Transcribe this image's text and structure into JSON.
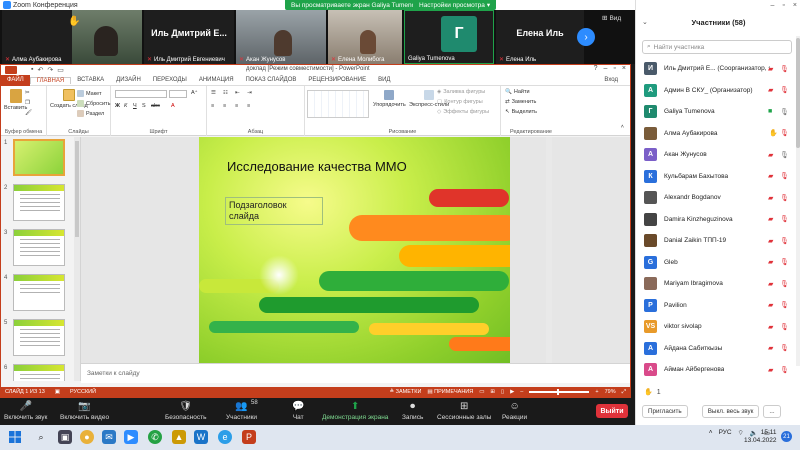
{
  "zoom": {
    "app_title": "Zoom Конференция",
    "share_banner": "Вы просматриваете экран Galiya Tumenova",
    "view_settings": "Настройки просмотра",
    "view_label": "Вид",
    "tiles": [
      {
        "name": "Алма Аубакирова",
        "type": "video",
        "raise_hand": true
      },
      {
        "name": "Иль Дмитрий Евгениевич",
        "big": "Иль Дмитрий Е...",
        "type": "name"
      },
      {
        "name": "Акан Жунусов",
        "type": "video"
      },
      {
        "name": "Елена Молибога",
        "type": "video"
      },
      {
        "name": "Galiya Tumenova",
        "letter": "Г",
        "type": "letter"
      },
      {
        "name": "Елена Иль",
        "big": "Елена Иль",
        "type": "name"
      }
    ],
    "controls": [
      {
        "label": "Включить звук",
        "icon": "🎤"
      },
      {
        "label": "Включить видео",
        "icon": "📷"
      },
      {
        "label": "Безопасность",
        "icon": "🛡"
      },
      {
        "label": "Участники",
        "icon": "👥",
        "count": "58"
      },
      {
        "label": "Чат",
        "icon": "💬"
      },
      {
        "label": "Демонстрация экрана",
        "icon": "⬆"
      },
      {
        "label": "Запись",
        "icon": "⏺"
      },
      {
        "label": "Сессионные залы",
        "icon": "⊞"
      },
      {
        "label": "Реакции",
        "icon": "☺"
      }
    ],
    "leave": "Выйти"
  },
  "ppt": {
    "title": "доклад [Режим совместимости] - PowerPoint",
    "file_tab": "ФАЙЛ",
    "tabs": [
      "ГЛАВНАЯ",
      "ВСТАВКА",
      "ДИЗАЙН",
      "ПЕРЕХОДЫ",
      "АНИМАЦИЯ",
      "ПОКАЗ СЛАЙДОВ",
      "РЕЦЕНЗИРОВАНИЕ",
      "ВИД"
    ],
    "signin": "Вход",
    "ribbon": {
      "paste": "Вставить",
      "cut": "",
      "copy": "Копировать",
      "format": "Формат по образцу",
      "clipboard": "Буфер обмена",
      "new_slide": "Создать слайд",
      "layout": "Макет",
      "reset": "Сбросить",
      "section": "Раздел",
      "slides": "Слайды",
      "font": "Шрифт",
      "paragraph": "Абзац",
      "arrange": "Упорядочить",
      "quick_styles": "Экспресс-стили",
      "fill": "Заливка фигуры",
      "outline": "Контур фигуры",
      "effects": "Эффекты фигуры",
      "drawing": "Рисование",
      "find": "Найти",
      "replace": "Заменить",
      "select": "Выделить",
      "editing": "Редактирование"
    },
    "slide_title": "Исследование качества ММО",
    "slide_sub": "Подзаголовок слайда",
    "notes": "Заметки к слайду",
    "status_left": "СЛАЙД 1 ИЗ 13",
    "status_lang": "РУССКИЙ",
    "status_notes": "ЗАМЕТКИ",
    "status_comments": "ПРИМЕЧАНИЯ",
    "zoom_level": "79%",
    "thumb_numbers": [
      "1",
      "2",
      "3",
      "4",
      "5",
      "6"
    ]
  },
  "panel": {
    "title": "Участники (58)",
    "search_placeholder": "Найти участника",
    "participants": [
      {
        "name": "Иль Дмитрий Е... (Соорганизатор, я)",
        "initial": "И",
        "color": "#4a5a6a",
        "mic": "off"
      },
      {
        "name": "Админ В СКУ_ (Организатор)",
        "initial": "А",
        "color": "#1f9b7e",
        "mic": "off"
      },
      {
        "name": "Galiya Tumenova",
        "initial": "Г",
        "color": "#1f8a6e",
        "mic": "on",
        "cam": true
      },
      {
        "name": "Алма Аубакирова",
        "initial": "",
        "color": "#7a5c3a",
        "mic": "off",
        "hand": true
      },
      {
        "name": "Акан Жунусов",
        "initial": "А",
        "color": "#7b5fc8",
        "mic": "on"
      },
      {
        "name": "Кульбарам Бахытова",
        "initial": "К",
        "color": "#2a6fdb",
        "mic": "off"
      },
      {
        "name": "Alexandr Bogdanov",
        "initial": "",
        "color": "#555555",
        "mic": "off"
      },
      {
        "name": "Damira Kinzheguzinova",
        "initial": "",
        "color": "#444444",
        "mic": "off"
      },
      {
        "name": "Danial Zaikin ТПП-19",
        "initial": "",
        "color": "#6a4a2a",
        "mic": "off"
      },
      {
        "name": "Gleb",
        "initial": "G",
        "color": "#2a6fdb",
        "mic": "off"
      },
      {
        "name": "Mariyam Ibragimova",
        "initial": "",
        "color": "#8a6a5a",
        "mic": "off"
      },
      {
        "name": "Pavilion",
        "initial": "P",
        "color": "#2a6fdb",
        "mic": "off"
      },
      {
        "name": "viktor sivolap",
        "initial": "VS",
        "color": "#e89a2a",
        "mic": "off"
      },
      {
        "name": "Айдана Сабиткызы",
        "initial": "А",
        "color": "#2a6fdb",
        "mic": "off"
      },
      {
        "name": "Айман Айбергенова",
        "initial": "А",
        "color": "#d94a8a",
        "mic": "off"
      }
    ],
    "raise_count": "1",
    "invite": "Пригласить",
    "mute_all": "Выкл. весь звук",
    "more": "..."
  },
  "taskbar": {
    "lang": "РУС",
    "time": "15:11",
    "date": "13.04.2022",
    "notifications": "21"
  }
}
